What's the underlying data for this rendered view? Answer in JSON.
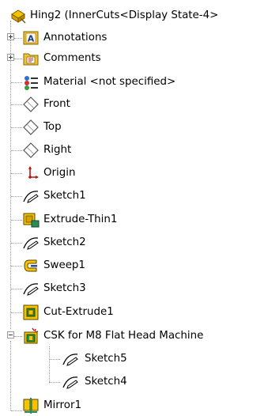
{
  "tree": {
    "root": {
      "label": "Hing2  (InnerCuts<Display State-4>",
      "icon": "part-icon"
    },
    "items": [
      {
        "label": "Annotations",
        "icon": "annotations-icon",
        "expander": "plus"
      },
      {
        "label": "Comments",
        "icon": "comments-folder-icon",
        "expander": "plus"
      },
      {
        "label": "Material <not specified>",
        "icon": "material-icon"
      },
      {
        "label": "Front",
        "icon": "plane-icon"
      },
      {
        "label": "Top",
        "icon": "plane-icon"
      },
      {
        "label": "Right",
        "icon": "plane-icon"
      },
      {
        "label": "Origin",
        "icon": "origin-icon"
      },
      {
        "label": "Sketch1",
        "icon": "sketch-icon"
      },
      {
        "label": "Extrude-Thin1",
        "icon": "extrude-thin-icon"
      },
      {
        "label": "Sketch2",
        "icon": "sketch-icon"
      },
      {
        "label": "Sweep1",
        "icon": "sweep-icon"
      },
      {
        "label": "Sketch3",
        "icon": "sketch-icon"
      },
      {
        "label": "Cut-Extrude1",
        "icon": "cut-extrude-icon"
      },
      {
        "label": "CSK for M8 Flat Head Machine",
        "icon": "hole-wizard-icon",
        "expander": "minus"
      },
      {
        "label": "Sketch5",
        "icon": "sketch-icon"
      },
      {
        "label": "Sketch4",
        "icon": "sketch-icon"
      },
      {
        "label": "Mirror1",
        "icon": "mirror-icon"
      }
    ]
  },
  "colors": {
    "tree_line": "#9a9a9a",
    "folder_yellow": "#f0c23a",
    "feature_yellow": "#f5c400",
    "sketch_blue": "#2b4fa5"
  }
}
